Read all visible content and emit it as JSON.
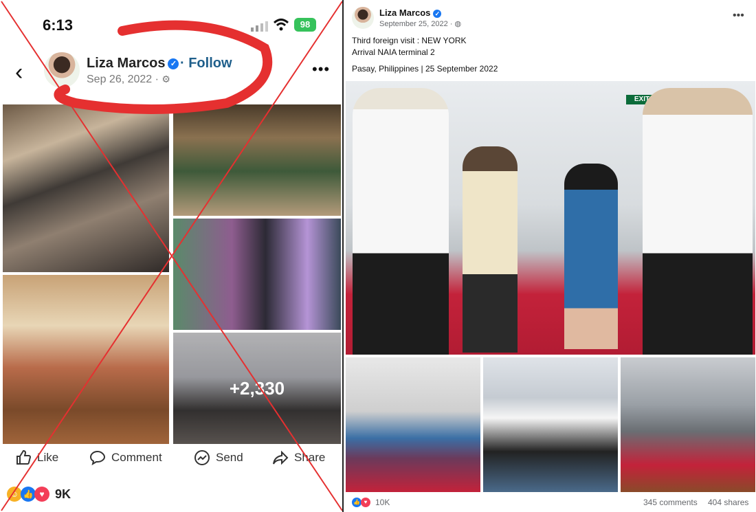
{
  "left_panel": {
    "status_bar": {
      "time": "6:13",
      "battery": "98"
    },
    "post_header": {
      "author": "Liza Marcos",
      "follow": "Follow",
      "date": "Sep 26, 2022"
    },
    "photo_overlay_count": "+2,330",
    "actions": {
      "like": "Like",
      "comment": "Comment",
      "send": "Send",
      "share": "Share"
    },
    "reaction_count": "9K"
  },
  "right_panel": {
    "author": "Liza Marcos",
    "date": "September 25, 2022 ·",
    "caption_line1": "Third foreign visit : NEW YORK",
    "caption_line2": "Arrival NAIA terminal 2",
    "location_line": "Pasay, Philippines | 25 September 2022",
    "exit_sign": "EXIT",
    "reaction_count": "10K",
    "comments": "345 comments",
    "shares": "404 shares"
  },
  "icons": [
    "back-arrow-icon",
    "verified-badge-icon",
    "gear-icon",
    "more-options-icon",
    "like-icon",
    "comment-icon",
    "send-icon",
    "share-icon",
    "globe-icon"
  ],
  "colors": {
    "facebook_blue": "#1877f2",
    "follow_blue": "#1f5f8b",
    "annotation_red": "#e53030",
    "battery_green": "#36c25b"
  }
}
